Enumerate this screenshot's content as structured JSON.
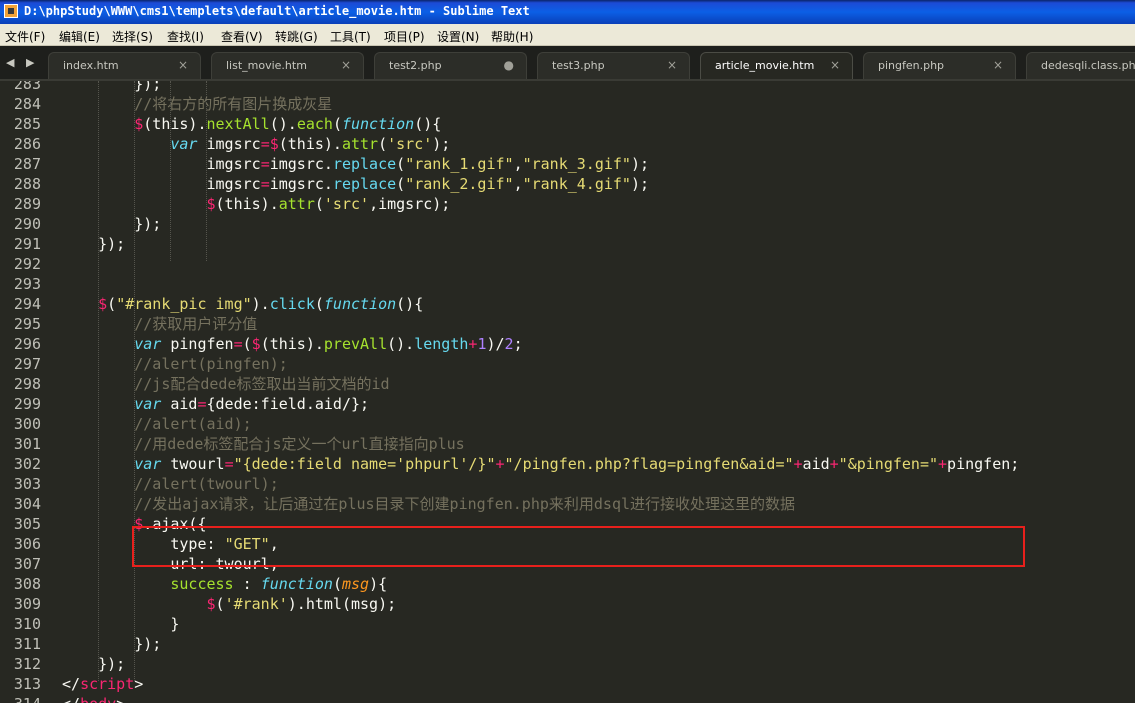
{
  "window": {
    "title": "D:\\phpStudy\\WWW\\cms1\\templets\\default\\article_movie.htm - Sublime Text"
  },
  "menu": [
    "文件(F)",
    "编辑(E)",
    "选择(S)",
    "查找(I)",
    "查看(V)",
    "转跳(G)",
    "工具(T)",
    "项目(P)",
    "设置(N)",
    "帮助(H)"
  ],
  "tabs": [
    {
      "label": "index.htm",
      "close": "×"
    },
    {
      "label": "list_movie.htm",
      "close": "×"
    },
    {
      "label": "test2.php",
      "close": "●"
    },
    {
      "label": "test3.php",
      "close": "×"
    },
    {
      "label": "article_movie.htm",
      "close": "×",
      "active": true
    },
    {
      "label": "pingfen.php",
      "close": "×"
    },
    {
      "label": "dedesqli.class.php",
      "close": ""
    }
  ],
  "nav_arrows": "◀ ▶",
  "line_numbers": [
    "283",
    "284",
    "285",
    "286",
    "287",
    "288",
    "289",
    "290",
    "291",
    "292",
    "293",
    "294",
    "295",
    "296",
    "297",
    "298",
    "299",
    "300",
    "301",
    "302",
    "303",
    "304",
    "305",
    "306",
    "307",
    "308",
    "309",
    "310",
    "311",
    "312",
    "313",
    "314"
  ],
  "colors": {
    "highlight_box": "#e8201c",
    "background": "#272822"
  },
  "code_lines": [
    [
      [
        "",
        "        });"
      ]
    ],
    [
      [
        "c",
        "        //将右方的所有图片换成灰星"
      ]
    ],
    [
      [
        "",
        "        "
      ],
      [
        "o",
        "$"
      ],
      [
        "",
        "(this)."
      ],
      [
        "g",
        "nextAll"
      ],
      [
        "",
        "()."
      ],
      [
        "g",
        "each"
      ],
      [
        "",
        "("
      ],
      [
        "k",
        "function"
      ],
      [
        "",
        "(){"
      ]
    ],
    [
      [
        "",
        "            "
      ],
      [
        "k",
        "var"
      ],
      [
        "",
        " imgsrc"
      ],
      [
        "o",
        "="
      ],
      [
        "o",
        "$"
      ],
      [
        "",
        "(this)."
      ],
      [
        "g",
        "attr"
      ],
      [
        "",
        "("
      ],
      [
        "s",
        "'src'"
      ],
      [
        "",
        ");"
      ]
    ],
    [
      [
        "",
        "                imgsrc"
      ],
      [
        "o",
        "="
      ],
      [
        "",
        "imgsrc."
      ],
      [
        "f",
        "replace"
      ],
      [
        "",
        "("
      ],
      [
        "s",
        "\"rank_1.gif\""
      ],
      [
        "",
        ","
      ],
      [
        "s",
        "\"rank_3.gif\""
      ],
      [
        "",
        ");"
      ]
    ],
    [
      [
        "",
        "                imgsrc"
      ],
      [
        "o",
        "="
      ],
      [
        "",
        "imgsrc."
      ],
      [
        "f",
        "replace"
      ],
      [
        "",
        "("
      ],
      [
        "s",
        "\"rank_2.gif\""
      ],
      [
        "",
        ","
      ],
      [
        "s",
        "\"rank_4.gif\""
      ],
      [
        "",
        ");"
      ]
    ],
    [
      [
        "",
        "                "
      ],
      [
        "o",
        "$"
      ],
      [
        "",
        "(this)."
      ],
      [
        "g",
        "attr"
      ],
      [
        "",
        "("
      ],
      [
        "s",
        "'src'"
      ],
      [
        "",
        ",imgsrc);"
      ]
    ],
    [
      [
        "",
        "        });"
      ]
    ],
    [
      [
        "",
        "    });"
      ]
    ],
    [
      [
        "",
        ""
      ]
    ],
    [
      [
        "",
        ""
      ]
    ],
    [
      [
        "",
        "    "
      ],
      [
        "o",
        "$"
      ],
      [
        "",
        "("
      ],
      [
        "s",
        "\"#rank_pic img\""
      ],
      [
        "",
        ")."
      ],
      [
        "f",
        "click"
      ],
      [
        "",
        "("
      ],
      [
        "k",
        "function"
      ],
      [
        "",
        "(){"
      ]
    ],
    [
      [
        "c",
        "        //获取用户评分值"
      ]
    ],
    [
      [
        "",
        "        "
      ],
      [
        "k",
        "var"
      ],
      [
        "",
        " pingfen"
      ],
      [
        "o",
        "="
      ],
      [
        "",
        "("
      ],
      [
        "o",
        "$"
      ],
      [
        "",
        "(this)."
      ],
      [
        "g",
        "prevAll"
      ],
      [
        "",
        "()."
      ],
      [
        "f",
        "length"
      ],
      [
        "o",
        "+"
      ],
      [
        "n",
        "1"
      ],
      [
        "",
        ")/"
      ],
      [
        "n",
        "2"
      ],
      [
        "",
        ";"
      ]
    ],
    [
      [
        "c",
        "        //alert(pingfen);"
      ]
    ],
    [
      [
        "c",
        "        //js配合dede标签取出当前文档的id"
      ]
    ],
    [
      [
        "",
        "        "
      ],
      [
        "k",
        "var"
      ],
      [
        "",
        " aid"
      ],
      [
        "o",
        "="
      ],
      [
        "",
        "{dede:field.aid/};"
      ]
    ],
    [
      [
        "c",
        "        //alert(aid);"
      ]
    ],
    [
      [
        "c",
        "        //用dede标签配合js定义一个url直接指向plus"
      ]
    ],
    [
      [
        "",
        "        "
      ],
      [
        "k",
        "var"
      ],
      [
        "",
        " twourl"
      ],
      [
        "o",
        "="
      ],
      [
        "s",
        "\"{dede:field name='phpurl'/}\""
      ],
      [
        "o",
        "+"
      ],
      [
        "s",
        "\"/pingfen.php?flag=pingfen&aid=\""
      ],
      [
        "o",
        "+"
      ],
      [
        "",
        "aid"
      ],
      [
        "o",
        "+"
      ],
      [
        "s",
        "\"&pingfen=\""
      ],
      [
        "o",
        "+"
      ],
      [
        "",
        "pingfen;"
      ]
    ],
    [
      [
        "c",
        "        //alert(twourl);"
      ]
    ],
    [
      [
        "c",
        "        //发出ajax请求，让后通过在plus目录下创建pingfen.php来利用dsql进行接收处理这里的数据"
      ]
    ],
    [
      [
        "",
        "        "
      ],
      [
        "o",
        "$"
      ],
      [
        "",
        "."
      ],
      [
        "",
        "ajax({"
      ]
    ],
    [
      [
        "",
        "            type: "
      ],
      [
        "s",
        "\"GET\""
      ],
      [
        "",
        ","
      ]
    ],
    [
      [
        "",
        "            url: twourl,"
      ]
    ],
    [
      [
        "",
        "            "
      ],
      [
        "g",
        "success"
      ],
      [
        "",
        " : "
      ],
      [
        "k",
        "function"
      ],
      [
        "",
        "("
      ],
      [
        "p",
        "msg"
      ],
      [
        "",
        "){"
      ]
    ],
    [
      [
        "",
        "                "
      ],
      [
        "o",
        "$"
      ],
      [
        "",
        "("
      ],
      [
        "s",
        "'#rank'"
      ],
      [
        "",
        ")."
      ],
      [
        "",
        "html(msg);"
      ]
    ],
    [
      [
        "",
        "            }"
      ]
    ],
    [
      [
        "",
        "        });"
      ]
    ],
    [
      [
        "",
        "    });"
      ]
    ],
    [
      [
        "",
        "</"
      ],
      [
        "t",
        "script"
      ],
      [
        "",
        ">"
      ]
    ],
    [
      [
        "",
        "</"
      ],
      [
        "t",
        "body"
      ],
      [
        "",
        ">"
      ]
    ]
  ]
}
